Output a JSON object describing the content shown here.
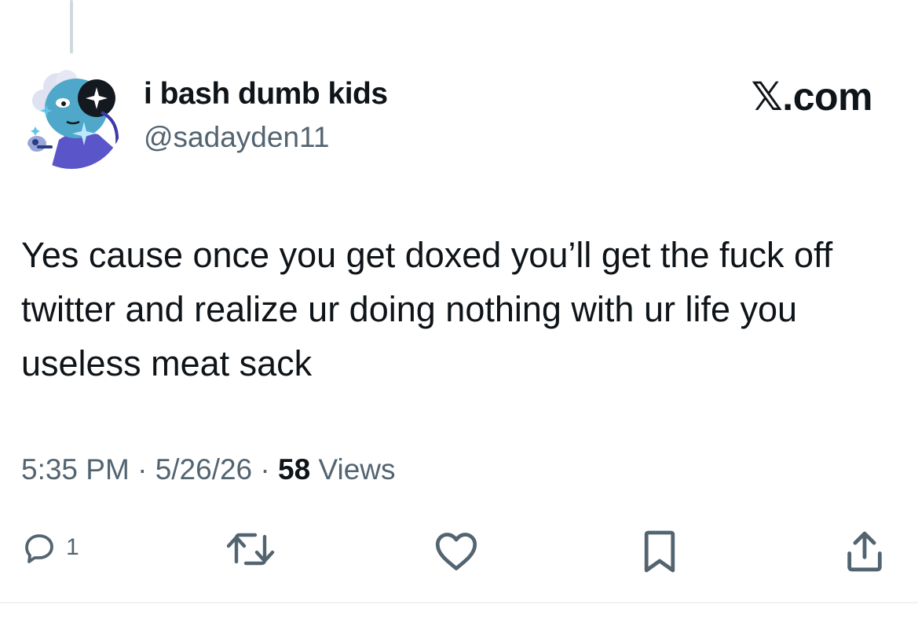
{
  "author": {
    "display_name": "i bash dumb kids",
    "handle": "@sadayden11",
    "avatar_icon": "cartoon-avatar"
  },
  "site_label": "𝕏.com",
  "tweet": {
    "text": "Yes cause once you get doxed you’ll get the fuck off twitter and realize ur doing nothing with ur life you useless meat sack"
  },
  "meta": {
    "time": "5:35 PM",
    "separator": "·",
    "date": "5/26/26",
    "views_count": "58",
    "views_label": "Views"
  },
  "actions": {
    "reply_icon": "speech-bubble-icon",
    "reply_count": "1",
    "retweet_icon": "retweet-arrows-icon",
    "like_icon": "heart-icon",
    "bookmark_icon": "bookmark-icon",
    "share_icon": "share-upload-icon"
  },
  "colors": {
    "text_primary": "#0f1419",
    "text_secondary": "#536471",
    "thread_line": "#cfd9de"
  }
}
